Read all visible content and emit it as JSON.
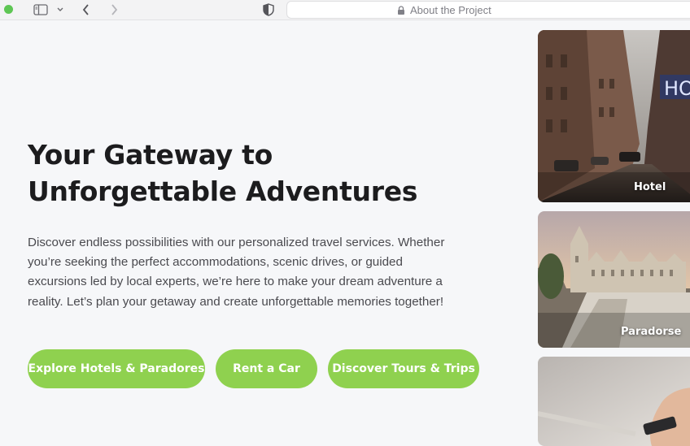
{
  "browser": {
    "address_text": "About the Project"
  },
  "hero": {
    "title": "Your Gateway to Unforgettable Adventures",
    "description": "Discover endless possibilities with our personalized travel services. Whether you’re seeking the perfect accommodations, scenic drives, or guided excursions led by local experts, we’re here to make your dream adventure a reality. Let’s plan your getaway and create unforgettable memories together!"
  },
  "buttons": {
    "hotels": "Explore Hotels & Paradores",
    "car": "Rent a Car",
    "tours": "Discover Tours & Trips"
  },
  "cards": {
    "hotel": "Hotel",
    "parador": "Paradorse",
    "hotel_sign": "HO"
  },
  "colors": {
    "accent": "#8fd14f",
    "heading": "#1c1c1e",
    "body_text": "#4a4a4f",
    "page_bg": "#f6f7f9"
  },
  "icons": {
    "window_control": "green-dot",
    "sidebar": "sidebar-toggle-icon",
    "back": "chevron-left-icon",
    "forward": "chevron-right-icon",
    "privacy": "shield-icon",
    "secure": "lock-icon"
  }
}
